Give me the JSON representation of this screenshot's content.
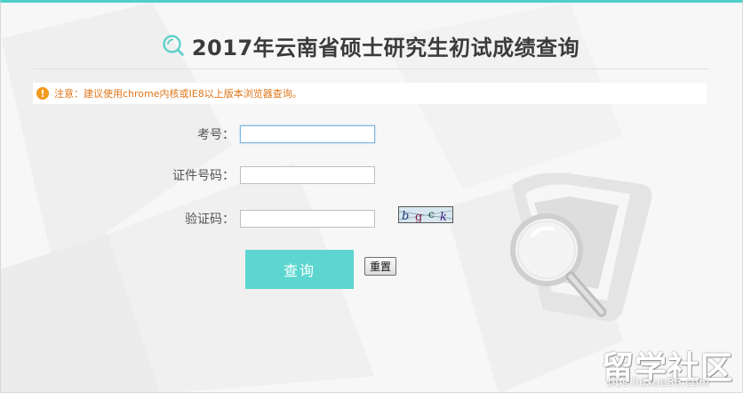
{
  "page": {
    "title": "2017年云南省硕士研究生初试成绩查询"
  },
  "notice": {
    "text": "注意：建议使用chrome内核或IE8以上版本浏览器查询。"
  },
  "form": {
    "exam_number_label": "考号：",
    "id_number_label": "证件号码：",
    "captcha_label": "验证码：",
    "exam_number_value": "",
    "id_number_value": "",
    "captcha_value": "",
    "captcha_image_text": "bgck",
    "query_button": "查询",
    "reset_button": "重置"
  },
  "watermark": {
    "brand": "留学社区",
    "url": "bbs.liuxue86.com"
  },
  "colors": {
    "accent": "#5cd6cf",
    "top_border": "#4fcfc9",
    "notice_text": "#e0761a",
    "notice_icon": "#f39a1e",
    "title": "#3b3b3b"
  },
  "icons": {
    "title_icon": "search-icon",
    "notice_icon": "exclamation-icon"
  }
}
